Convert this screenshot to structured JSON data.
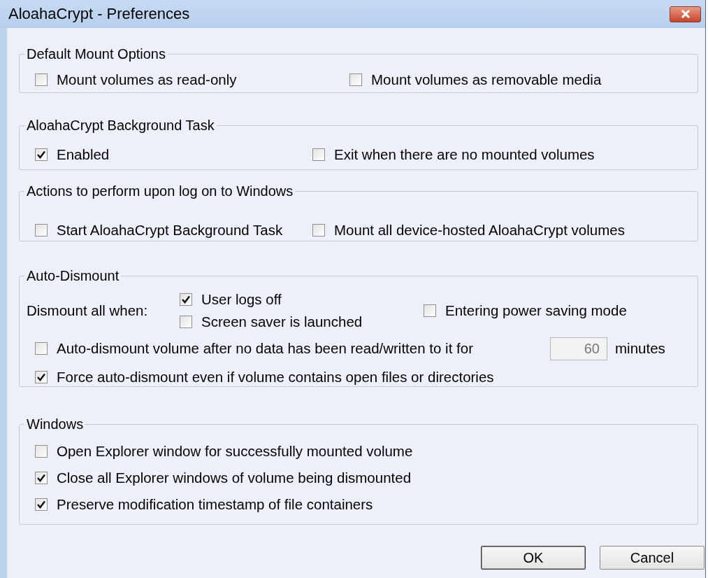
{
  "window": {
    "title": "AloahaCrypt - Preferences"
  },
  "groups": [
    {
      "title": "Default Mount Options",
      "controls": [
        {
          "kind": "checkbox",
          "label": "Mount volumes as read-only",
          "checked": false
        },
        {
          "kind": "checkbox",
          "label": "Mount volumes as removable media",
          "checked": false
        }
      ]
    },
    {
      "title": "AloahaCrypt Background Task",
      "controls": [
        {
          "kind": "checkbox",
          "label": "Enabled",
          "checked": true
        },
        {
          "kind": "checkbox",
          "label": "Exit when there are no mounted volumes",
          "checked": false
        }
      ]
    },
    {
      "title": "Actions to perform upon log on to Windows",
      "controls": [
        {
          "kind": "checkbox",
          "label": "Start AloahaCrypt Background Task",
          "checked": false
        },
        {
          "kind": "checkbox",
          "label": "Mount all device-hosted AloahaCrypt volumes",
          "checked": false
        }
      ]
    },
    {
      "title": "Auto-Dismount",
      "controls": [
        {
          "kind": "label",
          "label": "Dismount all when:"
        },
        {
          "kind": "checkbox",
          "label": "User logs off",
          "checked": true
        },
        {
          "kind": "checkbox",
          "label": "Screen saver is launched",
          "checked": false
        },
        {
          "kind": "checkbox",
          "label": "Entering power saving mode",
          "checked": false
        },
        {
          "kind": "checkbox",
          "label": "Auto-dismount volume after no data has been read/written to it for",
          "checked": false
        },
        {
          "kind": "field",
          "value": "60",
          "disabled": true
        },
        {
          "kind": "label",
          "label": "minutes"
        },
        {
          "kind": "checkbox",
          "label": "Force auto-dismount even if volume contains open files or directories",
          "checked": true
        }
      ]
    },
    {
      "title": "Windows",
      "controls": [
        {
          "kind": "checkbox",
          "label": "Open Explorer window for successfully mounted volume",
          "checked": false
        },
        {
          "kind": "checkbox",
          "label": "Close all Explorer windows of volume being dismounted",
          "checked": true
        },
        {
          "kind": "checkbox",
          "label": "Preserve modification timestamp of file containers",
          "checked": true
        }
      ]
    }
  ],
  "buttons": [
    {
      "label": "OK",
      "default": true
    },
    {
      "label": "Cancel",
      "default": false
    }
  ]
}
